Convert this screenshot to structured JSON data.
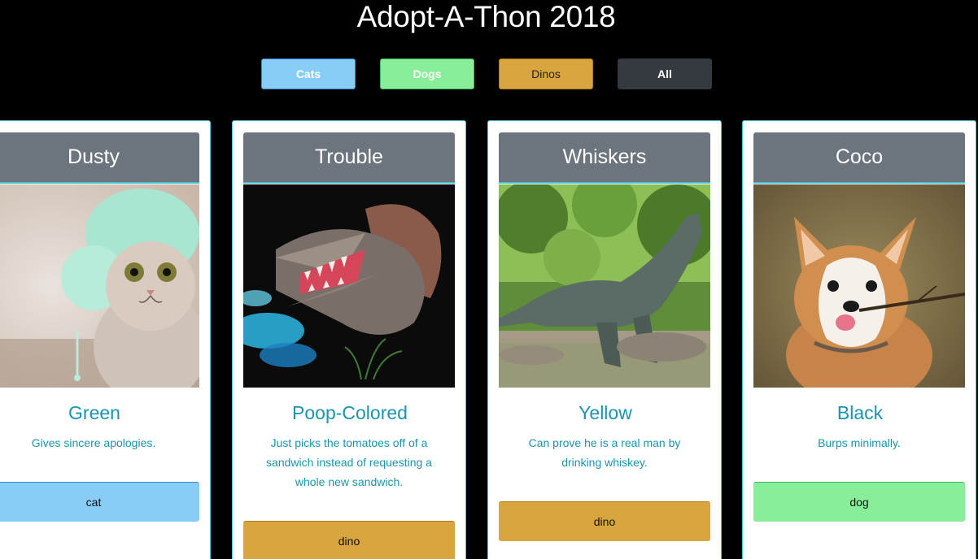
{
  "page": {
    "title": "Adopt-A-Thon 2018"
  },
  "filters": {
    "cats": "Cats",
    "dogs": "Dogs",
    "dinos": "Dinos",
    "all": "All"
  },
  "colors": {
    "cat": "#87cdf6",
    "dog": "#88ee99",
    "dino": "#d9a53e",
    "all": "#343a40",
    "card_header": "#6c757d",
    "accent_text": "#1b94ab",
    "card_border": "#48c9d4"
  },
  "pets": [
    {
      "name": "Dusty",
      "color": "Green",
      "description": "Gives sincere apologies.",
      "type": "cat",
      "image_icon": "cat-in-knit-hat-photo"
    },
    {
      "name": "Trouble",
      "color": "Poop-Colored",
      "description": "Just picks the tomatoes off of a sandwich instead of requesting a whole new sandwich.",
      "type": "dino",
      "image_icon": "spinosaurus-photo"
    },
    {
      "name": "Whiskers",
      "color": "Yellow",
      "description": "Can prove he is a real man by drinking whiskey.",
      "type": "dino",
      "image_icon": "t-rex-in-forest-photo"
    },
    {
      "name": "Coco",
      "color": "Black",
      "description": "Burps minimally.",
      "type": "dog",
      "image_icon": "corgi-with-stick-photo"
    }
  ]
}
